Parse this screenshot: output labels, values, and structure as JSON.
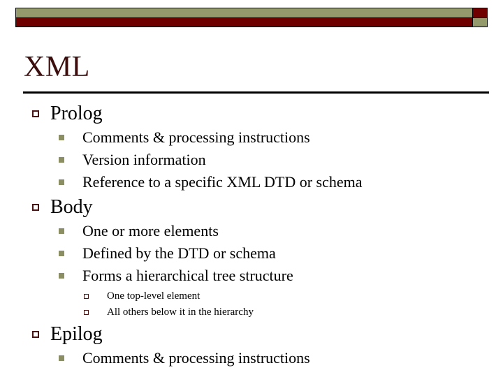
{
  "slide": {
    "title": "XML",
    "theme": {
      "olive": "#959A6C",
      "dark_red": "#6E0000",
      "title_color": "#3B0D0D",
      "bullet_l1_color": "#4A1414",
      "bullet_l2_color": "#8A8E62",
      "bullet_l3_color": "#4A1414",
      "rule_color": "#000000",
      "background": "#FFFFFF"
    },
    "banner": {
      "olive_bar": "olive-bar",
      "red_bar": "red-bar",
      "red_square": "red-square",
      "olive_square": "olive-square"
    },
    "outline": [
      {
        "level": 1,
        "text": "Prolog",
        "bullet": "hollow-square-bullet",
        "children": [
          {
            "level": 2,
            "text": "Comments & processing instructions",
            "bullet": "filled-square-bullet"
          },
          {
            "level": 2,
            "text": "Version information",
            "bullet": "filled-square-bullet"
          },
          {
            "level": 2,
            "text": "Reference to a specific XML DTD or schema",
            "bullet": "filled-square-bullet"
          }
        ]
      },
      {
        "level": 1,
        "text": "Body",
        "bullet": "hollow-square-bullet",
        "children": [
          {
            "level": 2,
            "text": "One or more elements",
            "bullet": "filled-square-bullet"
          },
          {
            "level": 2,
            "text": "Defined by the DTD or schema",
            "bullet": "filled-square-bullet"
          },
          {
            "level": 2,
            "text": "Forms a hierarchical tree structure",
            "bullet": "filled-square-bullet",
            "children": [
              {
                "level": 3,
                "text": "One top-level element",
                "bullet": "hollow-square-bullet"
              },
              {
                "level": 3,
                "text": "All others below it in the hierarchy",
                "bullet": "hollow-square-bullet"
              }
            ]
          }
        ]
      },
      {
        "level": 1,
        "text": "Epilog",
        "bullet": "hollow-square-bullet",
        "children": [
          {
            "level": 2,
            "text": "Comments & processing instructions",
            "bullet": "filled-square-bullet"
          }
        ]
      }
    ]
  }
}
